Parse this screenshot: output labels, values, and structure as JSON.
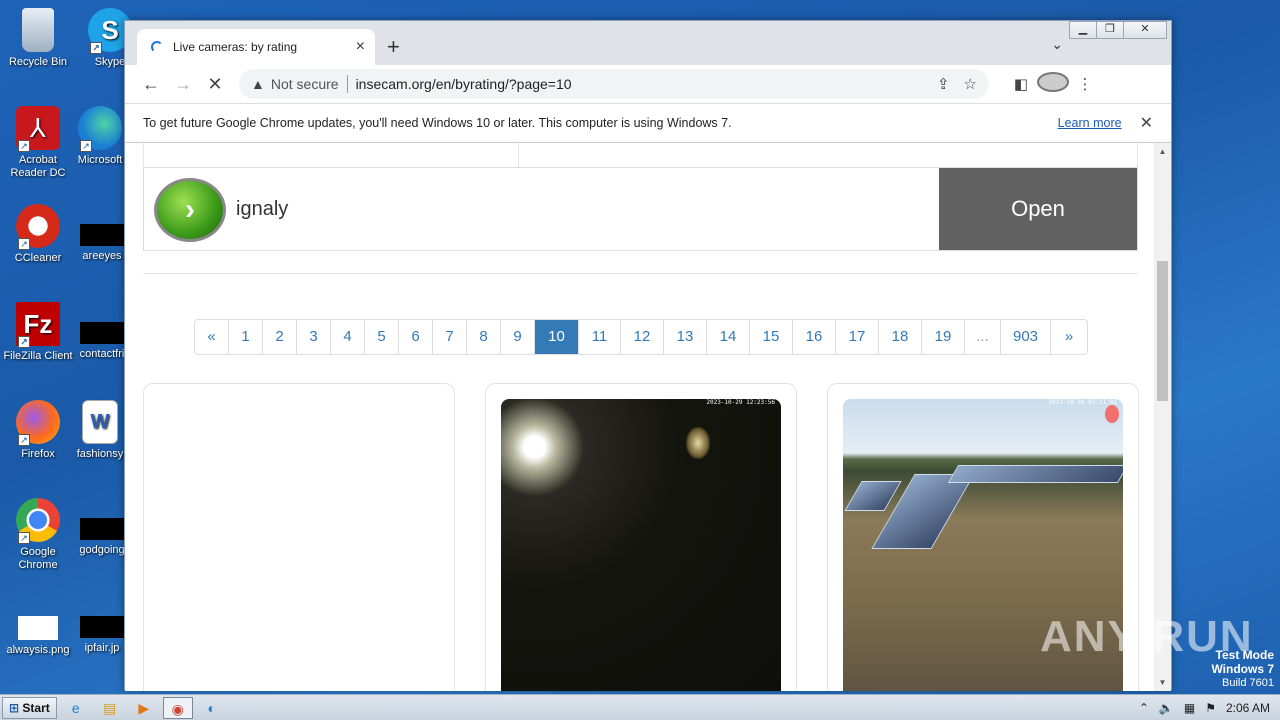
{
  "desktop": {
    "icons": [
      {
        "label": "Recycle Bin"
      },
      {
        "label": "Skype"
      },
      {
        "label": "Acrobat Reader DC"
      },
      {
        "label": "Microsoft"
      },
      {
        "label": "CCleaner"
      },
      {
        "label": "areeyes"
      },
      {
        "label": "FileZilla Client"
      },
      {
        "label": "contactfri"
      },
      {
        "label": "Firefox"
      },
      {
        "label": "fashionsy"
      },
      {
        "label": "Google Chrome"
      },
      {
        "label": "godgoing"
      },
      {
        "label": "alwaysis.png"
      },
      {
        "label": "ipfair.jp"
      }
    ],
    "watermark": "ANY RUN",
    "test_mode": {
      "line1": "Test Mode",
      "line2": "Windows 7",
      "line3": "Build 7601"
    }
  },
  "browser": {
    "tab_title": "Live cameras: by rating",
    "tab_close": "×",
    "new_tab": "+",
    "address": {
      "security_label": "Not secure",
      "url": "insecam.org/en/byrating/?page=10"
    },
    "infobar": {
      "message": "To get future Google Chrome updates, you'll need Windows 10 or later. This computer is using Windows 7.",
      "link": "Learn more"
    }
  },
  "page": {
    "ad": {
      "name": "ignaly",
      "button": "Open"
    },
    "pagination": [
      "«",
      "1",
      "2",
      "3",
      "4",
      "5",
      "6",
      "7",
      "8",
      "9",
      "10",
      "11",
      "12",
      "13",
      "14",
      "15",
      "16",
      "17",
      "18",
      "19",
      "...",
      "903",
      "»"
    ],
    "active_page": "10",
    "cameras": [
      {
        "timestamp": "2023-10-29 12:23:56"
      },
      {
        "timestamp": "2023-10-30 02:11:01"
      }
    ]
  },
  "taskbar": {
    "start": "Start",
    "clock": "2:06 AM"
  },
  "colors": {
    "accent": "#337ab7",
    "ad_button": "#616161",
    "desktop": "#1e63b8"
  }
}
